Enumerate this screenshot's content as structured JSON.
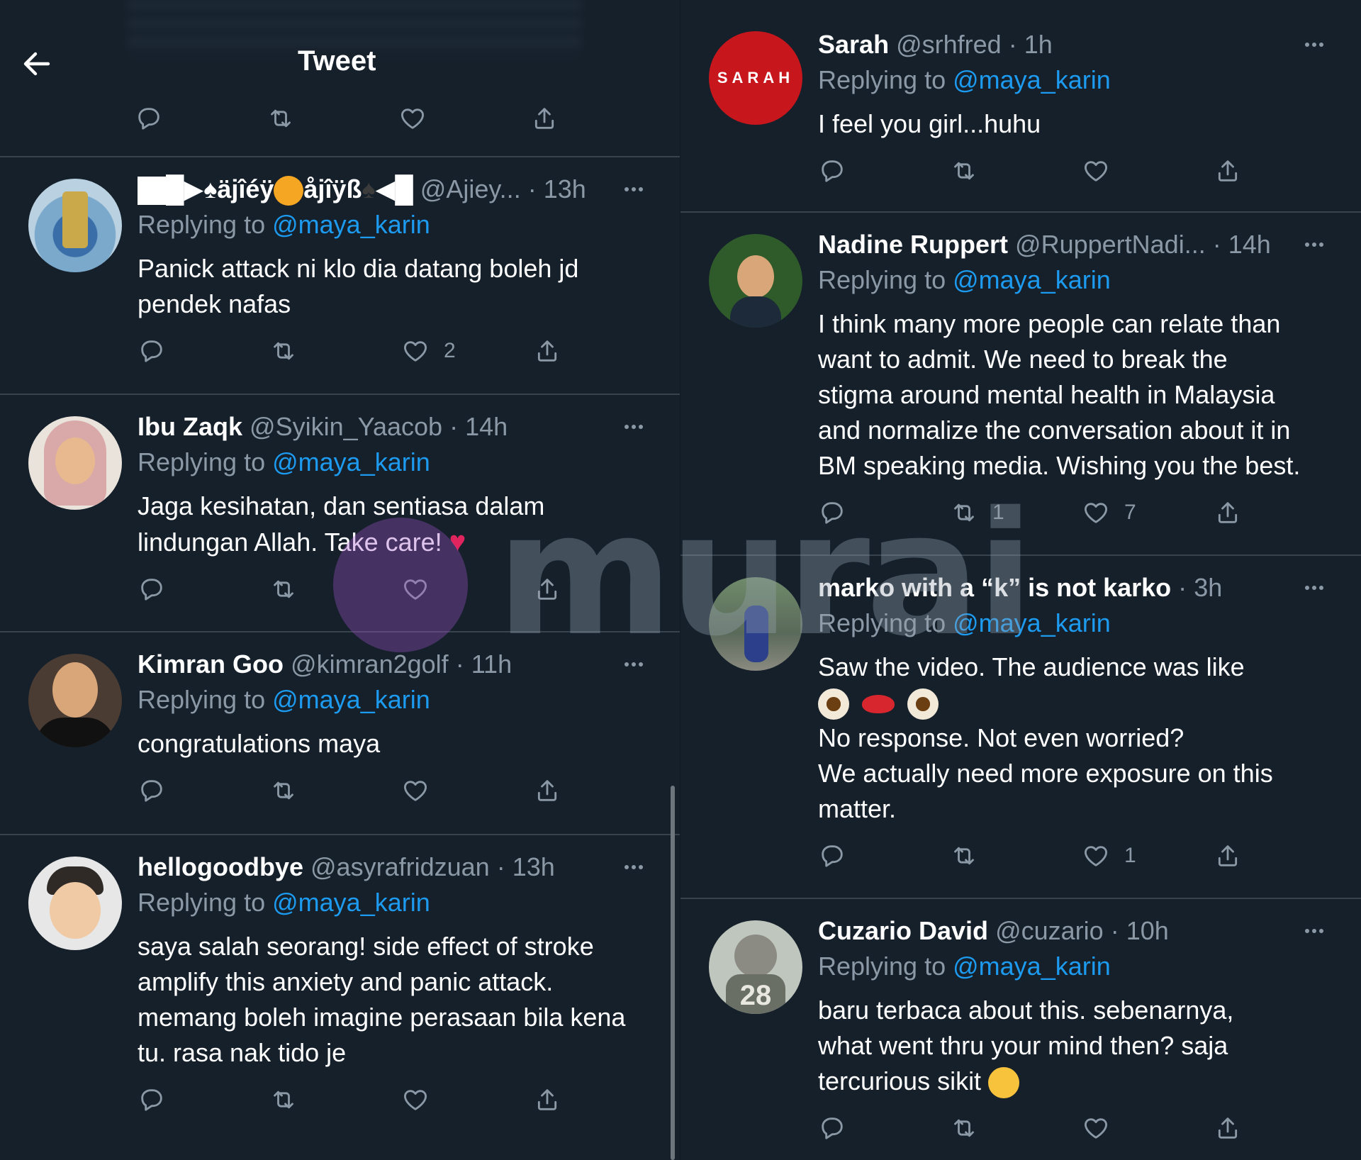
{
  "header": {
    "title": "Tweet",
    "back_label": "back"
  },
  "left_column": [
    {
      "name": "█▶♠äjîéÿ",
      "name2": "åjîÿß",
      "name3": "◀█",
      "handle": "@Ajiey...",
      "time": "13h",
      "replying_label": "Replying to",
      "mention": "@maya_karin",
      "text_lines": [
        "Panick attack  ni klo dia datang boleh jd",
        "pendek nafas"
      ],
      "likes": "2",
      "retweets": ""
    },
    {
      "name": "Ibu Zaqk",
      "handle": "@Syikin_Yaacob",
      "time": "14h",
      "replying_label": "Replying to",
      "mention": "@maya_karin",
      "text_lines": [
        "Jaga kesihatan, dan sentiasa dalam",
        "lindungan Allah. Take care!"
      ],
      "likes": "",
      "retweets": ""
    },
    {
      "name": "Kimran Goo",
      "handle": "@kimran2golf",
      "time": "11h",
      "replying_label": "Replying to",
      "mention": "@maya_karin",
      "text_lines": [
        "congratulations maya"
      ],
      "likes": "",
      "retweets": ""
    },
    {
      "name": "hellogoodbye",
      "handle": "@asyrafridzuan",
      "time": "13h",
      "replying_label": "Replying to",
      "mention": "@maya_karin",
      "text_lines": [
        "saya salah seorang! side effect of stroke",
        "amplify this anxiety and panic attack.",
        "memang boleh imagine perasaan bila kena",
        "tu. rasa nak tido je"
      ],
      "likes": "",
      "retweets": ""
    }
  ],
  "right_column": [
    {
      "name": "Sarah",
      "handle": "@srhfred",
      "time": "1h",
      "avatar_text": "SARAH",
      "replying_label": "Replying to",
      "mention": "@maya_karin",
      "text_lines": [
        "I feel you girl...huhu"
      ],
      "likes": "",
      "retweets": ""
    },
    {
      "name": "Nadine Ruppert",
      "handle": "@RuppertNadi...",
      "time": "14h",
      "replying_label": "Replying to",
      "mention": "@maya_karin",
      "text_lines": [
        "I think many more people can relate than",
        "want to admit. We need to break the",
        "stigma around mental health in Malaysia",
        "and normalize the conversation about it in",
        "BM speaking media. Wishing you the best."
      ],
      "likes": "7",
      "retweets": "1"
    },
    {
      "name": "marko with a “k” is not karko",
      "handle": "",
      "time": "3h",
      "replying_label": "Replying to",
      "mention": "@maya_karin",
      "text_lines": [
        "Saw the video. The audience was like"
      ],
      "text_lines_after": [
        "No response. Not even worried?",
        "We actually need more exposure on this",
        "matter."
      ],
      "likes": "1",
      "retweets": ""
    },
    {
      "name": "Cuzario David",
      "handle": "@cuzario",
      "time": "10h",
      "replying_label": "Replying to",
      "mention": "@maya_karin",
      "text_lines": [
        "baru terbaca about this. sebenarnya,",
        "what went thru your mind then? saja"
      ],
      "text_last": "tercurious sikit",
      "likes": "",
      "retweets": ""
    }
  ],
  "watermark": {
    "text": "murai"
  },
  "colors": {
    "background": "#15202b",
    "accent": "#1d9bf0",
    "muted": "#8b98a5",
    "separator": "#38444d"
  },
  "icons": [
    "back-arrow-icon",
    "reply-icon",
    "retweet-icon",
    "like-icon",
    "share-icon",
    "more-icon"
  ]
}
